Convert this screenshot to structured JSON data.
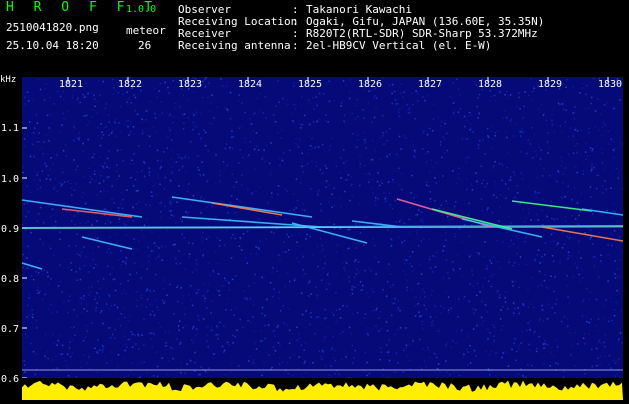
{
  "app": {
    "title": "H R O F F T",
    "version": "1.0.0"
  },
  "file": {
    "name": "2510041820.png",
    "timestamp": "25.10.04 18:20"
  },
  "meteor": {
    "label": "meteor",
    "count": "26"
  },
  "info": [
    {
      "label": "Observer",
      "value": "Takanori Kawachi"
    },
    {
      "label": "Receiving Location",
      "value": "Ogaki, Gifu, JAPAN (136.60E, 35.35N)"
    },
    {
      "label": "Receiver",
      "value": "R820T2(RTL-SDR) SDR-Sharp 53.372MHz"
    },
    {
      "label": "Receiving antenna",
      "value": "2el-HB9CV Vertical (el. E-W)"
    }
  ],
  "separator": ":",
  "y_axis": {
    "unit": "kHz",
    "ticks": [
      "1.1",
      "1.0",
      "0.9",
      "0.8",
      "0.7",
      "0.6"
    ]
  },
  "x_axis": {
    "ticks": [
      "1821",
      "1822",
      "1823",
      "1824",
      "1825",
      "1826",
      "1827",
      "1828",
      "1829",
      "1830"
    ]
  },
  "colors": {
    "title": "#00ff00",
    "plot_bg": "#050a78",
    "amplitude": "#ffee00",
    "strip": "#55aadd"
  }
}
